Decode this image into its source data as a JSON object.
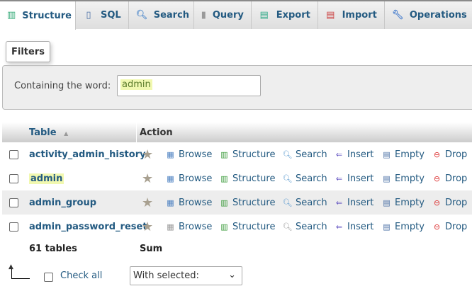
{
  "tabs": [
    {
      "label": "Structure",
      "icon": "structure-icon",
      "active": true
    },
    {
      "label": "SQL",
      "icon": "sql-icon"
    },
    {
      "label": "Search",
      "icon": "search-icon"
    },
    {
      "label": "Query",
      "icon": "query-icon"
    },
    {
      "label": "Export",
      "icon": "export-icon"
    },
    {
      "label": "Import",
      "icon": "import-icon"
    },
    {
      "label": "Operations",
      "icon": "wrench-icon"
    }
  ],
  "filters": {
    "legend": "Filters",
    "label": "Containing the word:",
    "value": "admin"
  },
  "table": {
    "headers": {
      "table": "Table",
      "action": "Action"
    },
    "actions": [
      "Browse",
      "Structure",
      "Search",
      "Insert",
      "Empty",
      "Drop"
    ],
    "rows": [
      {
        "name": "activity_admin_history"
      },
      {
        "name": "admin"
      },
      {
        "name": "admin_group"
      },
      {
        "name": "admin_password_reset"
      }
    ],
    "footer": {
      "count": "61 tables",
      "sum": "Sum"
    }
  },
  "bottom": {
    "check_all": "Check all",
    "with_selected": "With selected:"
  }
}
